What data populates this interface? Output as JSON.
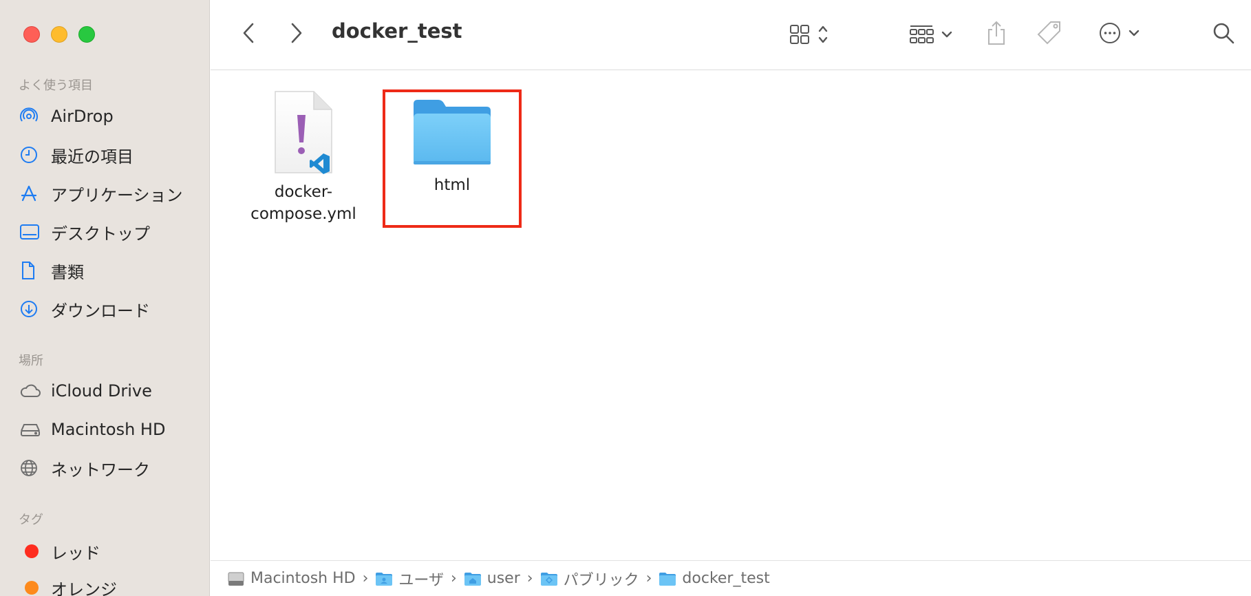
{
  "window": {
    "title": "docker_test"
  },
  "sidebar": {
    "favorites_header": "よく使う項目",
    "favorites": [
      {
        "label": "AirDrop",
        "icon": "airdrop-icon"
      },
      {
        "label": "最近の項目",
        "icon": "clock-icon"
      },
      {
        "label": "アプリケーション",
        "icon": "applications-icon"
      },
      {
        "label": "デスクトップ",
        "icon": "desktop-icon"
      },
      {
        "label": "書類",
        "icon": "document-icon"
      },
      {
        "label": "ダウンロード",
        "icon": "download-icon"
      }
    ],
    "locations_header": "場所",
    "locations": [
      {
        "label": "iCloud Drive",
        "icon": "cloud-icon"
      },
      {
        "label": "Macintosh HD",
        "icon": "harddrive-icon"
      },
      {
        "label": "ネットワーク",
        "icon": "network-icon"
      }
    ],
    "tags_header": "タグ",
    "tags": [
      {
        "label": "レッド",
        "color": "#fe2d1f"
      },
      {
        "label": "オレンジ",
        "color": "#fd8a1c"
      }
    ]
  },
  "files": [
    {
      "name_line1": "docker-",
      "name_line2": "compose.yml",
      "icon": "yaml-file-icon"
    },
    {
      "name_line1": "html",
      "icon": "folder-icon",
      "highlighted": true
    }
  ],
  "pathbar": {
    "items": [
      {
        "label": "Macintosh HD",
        "icon": "harddrive-icon"
      },
      {
        "label": "ユーザ",
        "icon": "users-folder-icon"
      },
      {
        "label": "user",
        "icon": "home-folder-icon"
      },
      {
        "label": "パブリック",
        "icon": "public-folder-icon"
      },
      {
        "label": "docker_test",
        "icon": "folder-icon"
      }
    ],
    "separator": "›"
  },
  "colors": {
    "accent": "#1e7cf2",
    "highlight_border": "#ee2a17",
    "folder": "#6cc4f5"
  }
}
